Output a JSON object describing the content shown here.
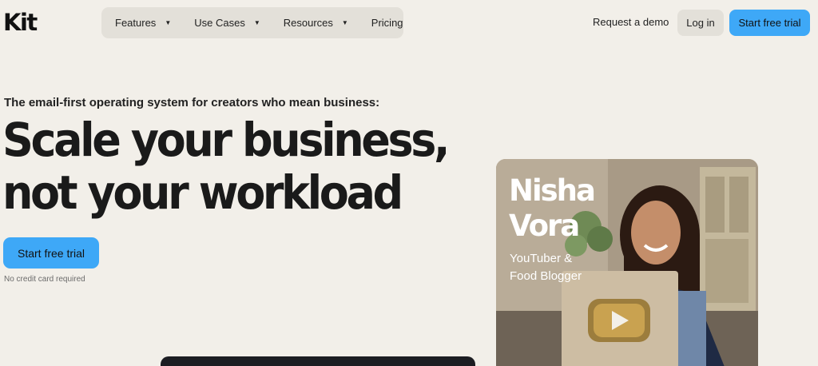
{
  "header": {
    "logo": "Kit",
    "nav": [
      {
        "label": "Features",
        "has_menu": true
      },
      {
        "label": "Use Cases",
        "has_menu": true
      },
      {
        "label": "Resources",
        "has_menu": true
      },
      {
        "label": "Pricing",
        "has_menu": false
      }
    ],
    "caret_glyph": "▼",
    "request_demo": "Request a demo",
    "login": "Log in",
    "start_trial": "Start free trial"
  },
  "hero": {
    "eyebrow": "The email-first operating system for creators who mean business:",
    "headline_line1": "Scale your business,",
    "headline_line2": "not your workload",
    "cta": "Start free trial",
    "note": "No credit card required"
  },
  "testimonial_card": {
    "name_line1": "Nisha",
    "name_line2": "Vora",
    "role_line1": "YouTuber &",
    "role_line2": "Food Blogger"
  },
  "colors": {
    "background": "#f2efe9",
    "nav_bg": "#e3e0d9",
    "primary_button": "#3ea8f7",
    "text": "#1a1a1a"
  }
}
